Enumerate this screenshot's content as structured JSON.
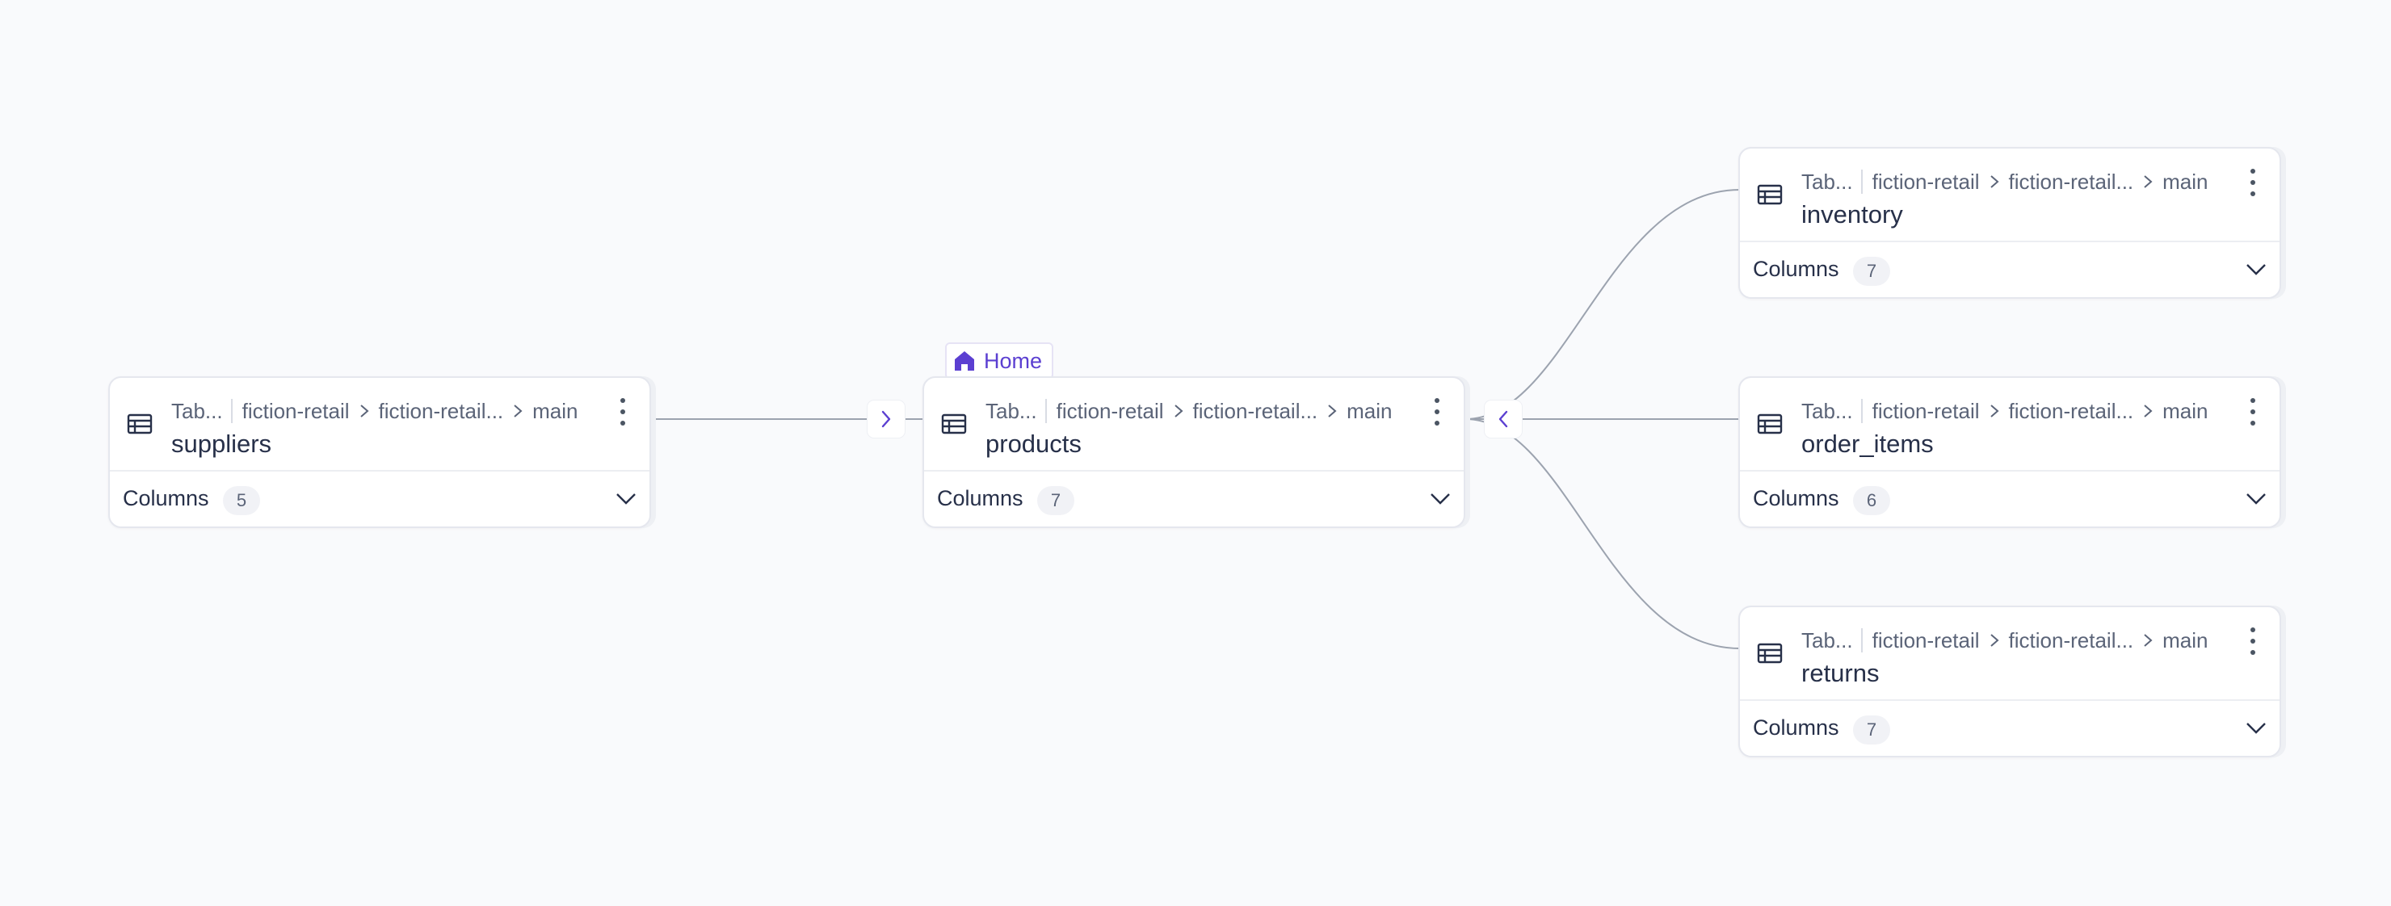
{
  "nodes": {
    "suppliers": {
      "type_label": "Tab...",
      "catalog": "fiction-retail",
      "schema": "fiction-retail...",
      "branch": "main",
      "title": "suppliers",
      "columns_label": "Columns",
      "columns_count": "5"
    },
    "products": {
      "type_label": "Tab...",
      "catalog": "fiction-retail",
      "schema": "fiction-retail...",
      "branch": "main",
      "title": "products",
      "columns_label": "Columns",
      "columns_count": "7"
    },
    "inventory": {
      "type_label": "Tab...",
      "catalog": "fiction-retail",
      "schema": "fiction-retail...",
      "branch": "main",
      "title": "inventory",
      "columns_label": "Columns",
      "columns_count": "7"
    },
    "order_items": {
      "type_label": "Tab...",
      "catalog": "fiction-retail",
      "schema": "fiction-retail...",
      "branch": "main",
      "title": "order_items",
      "columns_label": "Columns",
      "columns_count": "6"
    },
    "returns": {
      "type_label": "Tab...",
      "catalog": "fiction-retail",
      "schema": "fiction-retail...",
      "branch": "main",
      "title": "returns",
      "columns_label": "Columns",
      "columns_count": "7"
    }
  },
  "home_tag": {
    "label": "Home",
    "icon": "home-icon"
  },
  "colors": {
    "accent": "#5b3fd1",
    "edge": "#9ca3af",
    "background": "#f9fafc"
  }
}
